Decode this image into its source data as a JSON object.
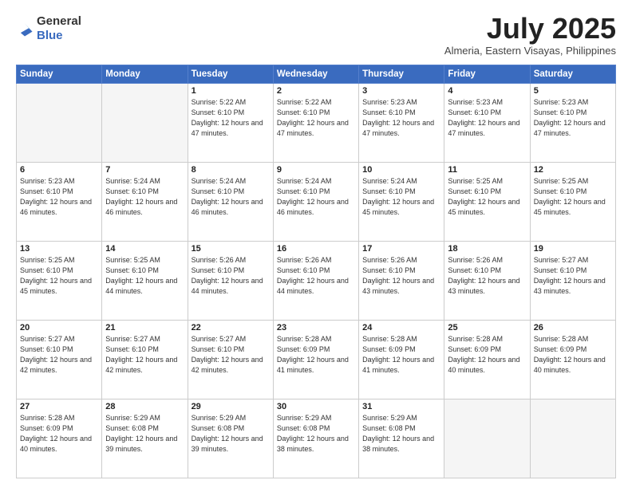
{
  "header": {
    "logo_general": "General",
    "logo_blue": "Blue",
    "title": "July 2025",
    "location": "Almeria, Eastern Visayas, Philippines"
  },
  "weekdays": [
    "Sunday",
    "Monday",
    "Tuesday",
    "Wednesday",
    "Thursday",
    "Friday",
    "Saturday"
  ],
  "weeks": [
    [
      {
        "day": "",
        "sunrise": "",
        "sunset": "",
        "daylight": ""
      },
      {
        "day": "",
        "sunrise": "",
        "sunset": "",
        "daylight": ""
      },
      {
        "day": "1",
        "sunrise": "Sunrise: 5:22 AM",
        "sunset": "Sunset: 6:10 PM",
        "daylight": "Daylight: 12 hours and 47 minutes."
      },
      {
        "day": "2",
        "sunrise": "Sunrise: 5:22 AM",
        "sunset": "Sunset: 6:10 PM",
        "daylight": "Daylight: 12 hours and 47 minutes."
      },
      {
        "day": "3",
        "sunrise": "Sunrise: 5:23 AM",
        "sunset": "Sunset: 6:10 PM",
        "daylight": "Daylight: 12 hours and 47 minutes."
      },
      {
        "day": "4",
        "sunrise": "Sunrise: 5:23 AM",
        "sunset": "Sunset: 6:10 PM",
        "daylight": "Daylight: 12 hours and 47 minutes."
      },
      {
        "day": "5",
        "sunrise": "Sunrise: 5:23 AM",
        "sunset": "Sunset: 6:10 PM",
        "daylight": "Daylight: 12 hours and 47 minutes."
      }
    ],
    [
      {
        "day": "6",
        "sunrise": "Sunrise: 5:23 AM",
        "sunset": "Sunset: 6:10 PM",
        "daylight": "Daylight: 12 hours and 46 minutes."
      },
      {
        "day": "7",
        "sunrise": "Sunrise: 5:24 AM",
        "sunset": "Sunset: 6:10 PM",
        "daylight": "Daylight: 12 hours and 46 minutes."
      },
      {
        "day": "8",
        "sunrise": "Sunrise: 5:24 AM",
        "sunset": "Sunset: 6:10 PM",
        "daylight": "Daylight: 12 hours and 46 minutes."
      },
      {
        "day": "9",
        "sunrise": "Sunrise: 5:24 AM",
        "sunset": "Sunset: 6:10 PM",
        "daylight": "Daylight: 12 hours and 46 minutes."
      },
      {
        "day": "10",
        "sunrise": "Sunrise: 5:24 AM",
        "sunset": "Sunset: 6:10 PM",
        "daylight": "Daylight: 12 hours and 45 minutes."
      },
      {
        "day": "11",
        "sunrise": "Sunrise: 5:25 AM",
        "sunset": "Sunset: 6:10 PM",
        "daylight": "Daylight: 12 hours and 45 minutes."
      },
      {
        "day": "12",
        "sunrise": "Sunrise: 5:25 AM",
        "sunset": "Sunset: 6:10 PM",
        "daylight": "Daylight: 12 hours and 45 minutes."
      }
    ],
    [
      {
        "day": "13",
        "sunrise": "Sunrise: 5:25 AM",
        "sunset": "Sunset: 6:10 PM",
        "daylight": "Daylight: 12 hours and 45 minutes."
      },
      {
        "day": "14",
        "sunrise": "Sunrise: 5:25 AM",
        "sunset": "Sunset: 6:10 PM",
        "daylight": "Daylight: 12 hours and 44 minutes."
      },
      {
        "day": "15",
        "sunrise": "Sunrise: 5:26 AM",
        "sunset": "Sunset: 6:10 PM",
        "daylight": "Daylight: 12 hours and 44 minutes."
      },
      {
        "day": "16",
        "sunrise": "Sunrise: 5:26 AM",
        "sunset": "Sunset: 6:10 PM",
        "daylight": "Daylight: 12 hours and 44 minutes."
      },
      {
        "day": "17",
        "sunrise": "Sunrise: 5:26 AM",
        "sunset": "Sunset: 6:10 PM",
        "daylight": "Daylight: 12 hours and 43 minutes."
      },
      {
        "day": "18",
        "sunrise": "Sunrise: 5:26 AM",
        "sunset": "Sunset: 6:10 PM",
        "daylight": "Daylight: 12 hours and 43 minutes."
      },
      {
        "day": "19",
        "sunrise": "Sunrise: 5:27 AM",
        "sunset": "Sunset: 6:10 PM",
        "daylight": "Daylight: 12 hours and 43 minutes."
      }
    ],
    [
      {
        "day": "20",
        "sunrise": "Sunrise: 5:27 AM",
        "sunset": "Sunset: 6:10 PM",
        "daylight": "Daylight: 12 hours and 42 minutes."
      },
      {
        "day": "21",
        "sunrise": "Sunrise: 5:27 AM",
        "sunset": "Sunset: 6:10 PM",
        "daylight": "Daylight: 12 hours and 42 minutes."
      },
      {
        "day": "22",
        "sunrise": "Sunrise: 5:27 AM",
        "sunset": "Sunset: 6:10 PM",
        "daylight": "Daylight: 12 hours and 42 minutes."
      },
      {
        "day": "23",
        "sunrise": "Sunrise: 5:28 AM",
        "sunset": "Sunset: 6:09 PM",
        "daylight": "Daylight: 12 hours and 41 minutes."
      },
      {
        "day": "24",
        "sunrise": "Sunrise: 5:28 AM",
        "sunset": "Sunset: 6:09 PM",
        "daylight": "Daylight: 12 hours and 41 minutes."
      },
      {
        "day": "25",
        "sunrise": "Sunrise: 5:28 AM",
        "sunset": "Sunset: 6:09 PM",
        "daylight": "Daylight: 12 hours and 40 minutes."
      },
      {
        "day": "26",
        "sunrise": "Sunrise: 5:28 AM",
        "sunset": "Sunset: 6:09 PM",
        "daylight": "Daylight: 12 hours and 40 minutes."
      }
    ],
    [
      {
        "day": "27",
        "sunrise": "Sunrise: 5:28 AM",
        "sunset": "Sunset: 6:09 PM",
        "daylight": "Daylight: 12 hours and 40 minutes."
      },
      {
        "day": "28",
        "sunrise": "Sunrise: 5:29 AM",
        "sunset": "Sunset: 6:08 PM",
        "daylight": "Daylight: 12 hours and 39 minutes."
      },
      {
        "day": "29",
        "sunrise": "Sunrise: 5:29 AM",
        "sunset": "Sunset: 6:08 PM",
        "daylight": "Daylight: 12 hours and 39 minutes."
      },
      {
        "day": "30",
        "sunrise": "Sunrise: 5:29 AM",
        "sunset": "Sunset: 6:08 PM",
        "daylight": "Daylight: 12 hours and 38 minutes."
      },
      {
        "day": "31",
        "sunrise": "Sunrise: 5:29 AM",
        "sunset": "Sunset: 6:08 PM",
        "daylight": "Daylight: 12 hours and 38 minutes."
      },
      {
        "day": "",
        "sunrise": "",
        "sunset": "",
        "daylight": ""
      },
      {
        "day": "",
        "sunrise": "",
        "sunset": "",
        "daylight": ""
      }
    ]
  ]
}
